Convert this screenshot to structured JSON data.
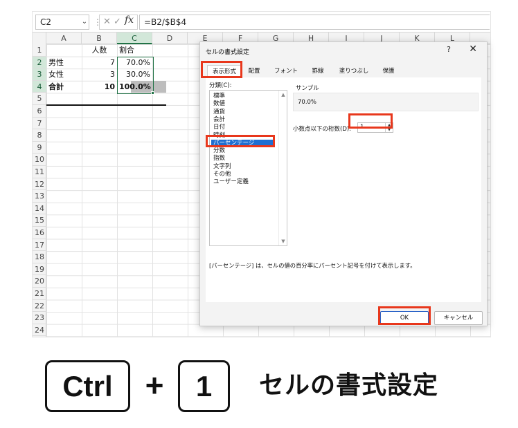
{
  "excel": {
    "name_box": "C2",
    "formula": "=B2/$B$4",
    "fx_label": "fx",
    "columns": [
      "A",
      "B",
      "C",
      "D",
      "E",
      "F",
      "G",
      "H",
      "I",
      "J",
      "K",
      "L"
    ],
    "active_column": "C",
    "rows": [
      "1",
      "2",
      "3",
      "4",
      "5",
      "6",
      "7",
      "8",
      "9",
      "10",
      "11",
      "12",
      "13",
      "14",
      "15",
      "16",
      "17",
      "18",
      "19",
      "20",
      "21",
      "22",
      "23",
      "24"
    ],
    "cells": {
      "b1": "人数",
      "c1": "割合",
      "a2": "男性",
      "b2": "7",
      "c2": "70.0%",
      "a3": "女性",
      "b3": "3",
      "c3": "30.0%",
      "a4": "合計",
      "b4": "10",
      "c4": "100.0%"
    },
    "colors": {
      "accent": "#217346",
      "selection_fill": "#d2e7d9",
      "c3_fill": "#bdbdbd"
    }
  },
  "dialog": {
    "title": "セルの書式設定",
    "help": "?",
    "close": "✕",
    "tabs": [
      "表示形式",
      "配置",
      "フォント",
      "罫線",
      "塗りつぶし",
      "保護"
    ],
    "active_tab": "表示形式",
    "category_label": "分類(C):",
    "categories": [
      "標準",
      "数値",
      "通貨",
      "会計",
      "日付",
      "時刻",
      "パーセンテージ",
      "分数",
      "指数",
      "文字列",
      "その他",
      "ユーザー定義"
    ],
    "selected_category": "パーセンテージ",
    "sample_label": "サンプル",
    "sample_value": "70.0%",
    "decimal_label": "小数点以下の桁数(D):",
    "decimal_value": "1",
    "description": "[パーセンテージ] は、セルの値の百分率にパーセント記号を付けて表示します。",
    "ok": "OK",
    "cancel": "キャンセル",
    "highlight_color": "#e8371c",
    "selected_color": "#1f6fd1"
  },
  "caption": {
    "key1": "Ctrl",
    "plus": "+",
    "key2": "1",
    "label": "セルの書式設定"
  }
}
